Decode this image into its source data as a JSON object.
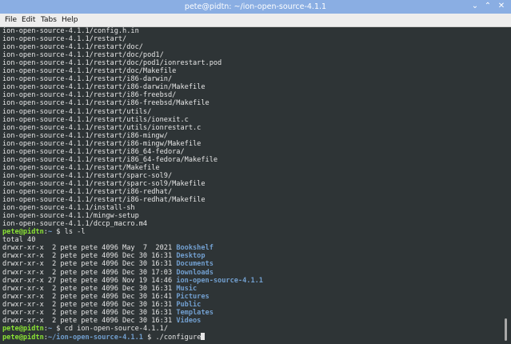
{
  "window": {
    "title": "pete@pidtn: ~/ion-open-source-4.1.1",
    "minimize_glyph": "⌄",
    "maximize_glyph": "⌃",
    "close_glyph": "✕"
  },
  "menu": [
    "File",
    "Edit",
    "Tabs",
    "Help"
  ],
  "terminal": {
    "file_lines": [
      "ion-open-source-4.1.1/config.h.in",
      "ion-open-source-4.1.1/restart/",
      "ion-open-source-4.1.1/restart/doc/",
      "ion-open-source-4.1.1/restart/doc/pod1/",
      "ion-open-source-4.1.1/restart/doc/pod1/ionrestart.pod",
      "ion-open-source-4.1.1/restart/doc/Makefile",
      "ion-open-source-4.1.1/restart/i86-darwin/",
      "ion-open-source-4.1.1/restart/i86-darwin/Makefile",
      "ion-open-source-4.1.1/restart/i86-freebsd/",
      "ion-open-source-4.1.1/restart/i86-freebsd/Makefile",
      "ion-open-source-4.1.1/restart/utils/",
      "ion-open-source-4.1.1/restart/utils/ionexit.c",
      "ion-open-source-4.1.1/restart/utils/ionrestart.c",
      "ion-open-source-4.1.1/restart/i86-mingw/",
      "ion-open-source-4.1.1/restart/i86-mingw/Makefile",
      "ion-open-source-4.1.1/restart/i86_64-fedora/",
      "ion-open-source-4.1.1/restart/i86_64-fedora/Makefile",
      "ion-open-source-4.1.1/restart/Makefile",
      "ion-open-source-4.1.1/restart/sparc-sol9/",
      "ion-open-source-4.1.1/restart/sparc-sol9/Makefile",
      "ion-open-source-4.1.1/restart/i86-redhat/",
      "ion-open-source-4.1.1/restart/i86-redhat/Makefile",
      "ion-open-source-4.1.1/install-sh",
      "ion-open-source-4.1.1/mingw-setup",
      "ion-open-source-4.1.1/dccp_macro.m4"
    ],
    "prompt_user": "pete@pidtn",
    "prompt_colon": ":",
    "prompt_dollar": " $ ",
    "cmd1": {
      "path": "~",
      "command": "ls -l"
    },
    "total": "total 40",
    "listing": [
      {
        "meta": "drwxr-xr-x  2 pete pete 4096 May  7  2021 ",
        "name": "Bookshelf"
      },
      {
        "meta": "drwxr-xr-x  2 pete pete 4096 Dec 30 16:31 ",
        "name": "Desktop"
      },
      {
        "meta": "drwxr-xr-x  2 pete pete 4096 Dec 30 16:31 ",
        "name": "Documents"
      },
      {
        "meta": "drwxr-xr-x  2 pete pete 4096 Dec 30 17:03 ",
        "name": "Downloads"
      },
      {
        "meta": "drwxr-xr-x 27 pete pete 4096 Nov 19 14:46 ",
        "name": "ion-open-source-4.1.1"
      },
      {
        "meta": "drwxr-xr-x  2 pete pete 4096 Dec 30 16:31 ",
        "name": "Music"
      },
      {
        "meta": "drwxr-xr-x  2 pete pete 4096 Dec 30 16:41 ",
        "name": "Pictures"
      },
      {
        "meta": "drwxr-xr-x  2 pete pete 4096 Dec 30 16:31 ",
        "name": "Public"
      },
      {
        "meta": "drwxr-xr-x  2 pete pete 4096 Dec 30 16:31 ",
        "name": "Templates"
      },
      {
        "meta": "drwxr-xr-x  2 pete pete 4096 Dec 30 16:31 ",
        "name": "Videos"
      }
    ],
    "cmd2": {
      "path": "~",
      "command": "cd ion-open-source-4.1.1/"
    },
    "cmd3": {
      "path": "~/ion-open-source-4.1.1",
      "command": "./configure"
    }
  }
}
